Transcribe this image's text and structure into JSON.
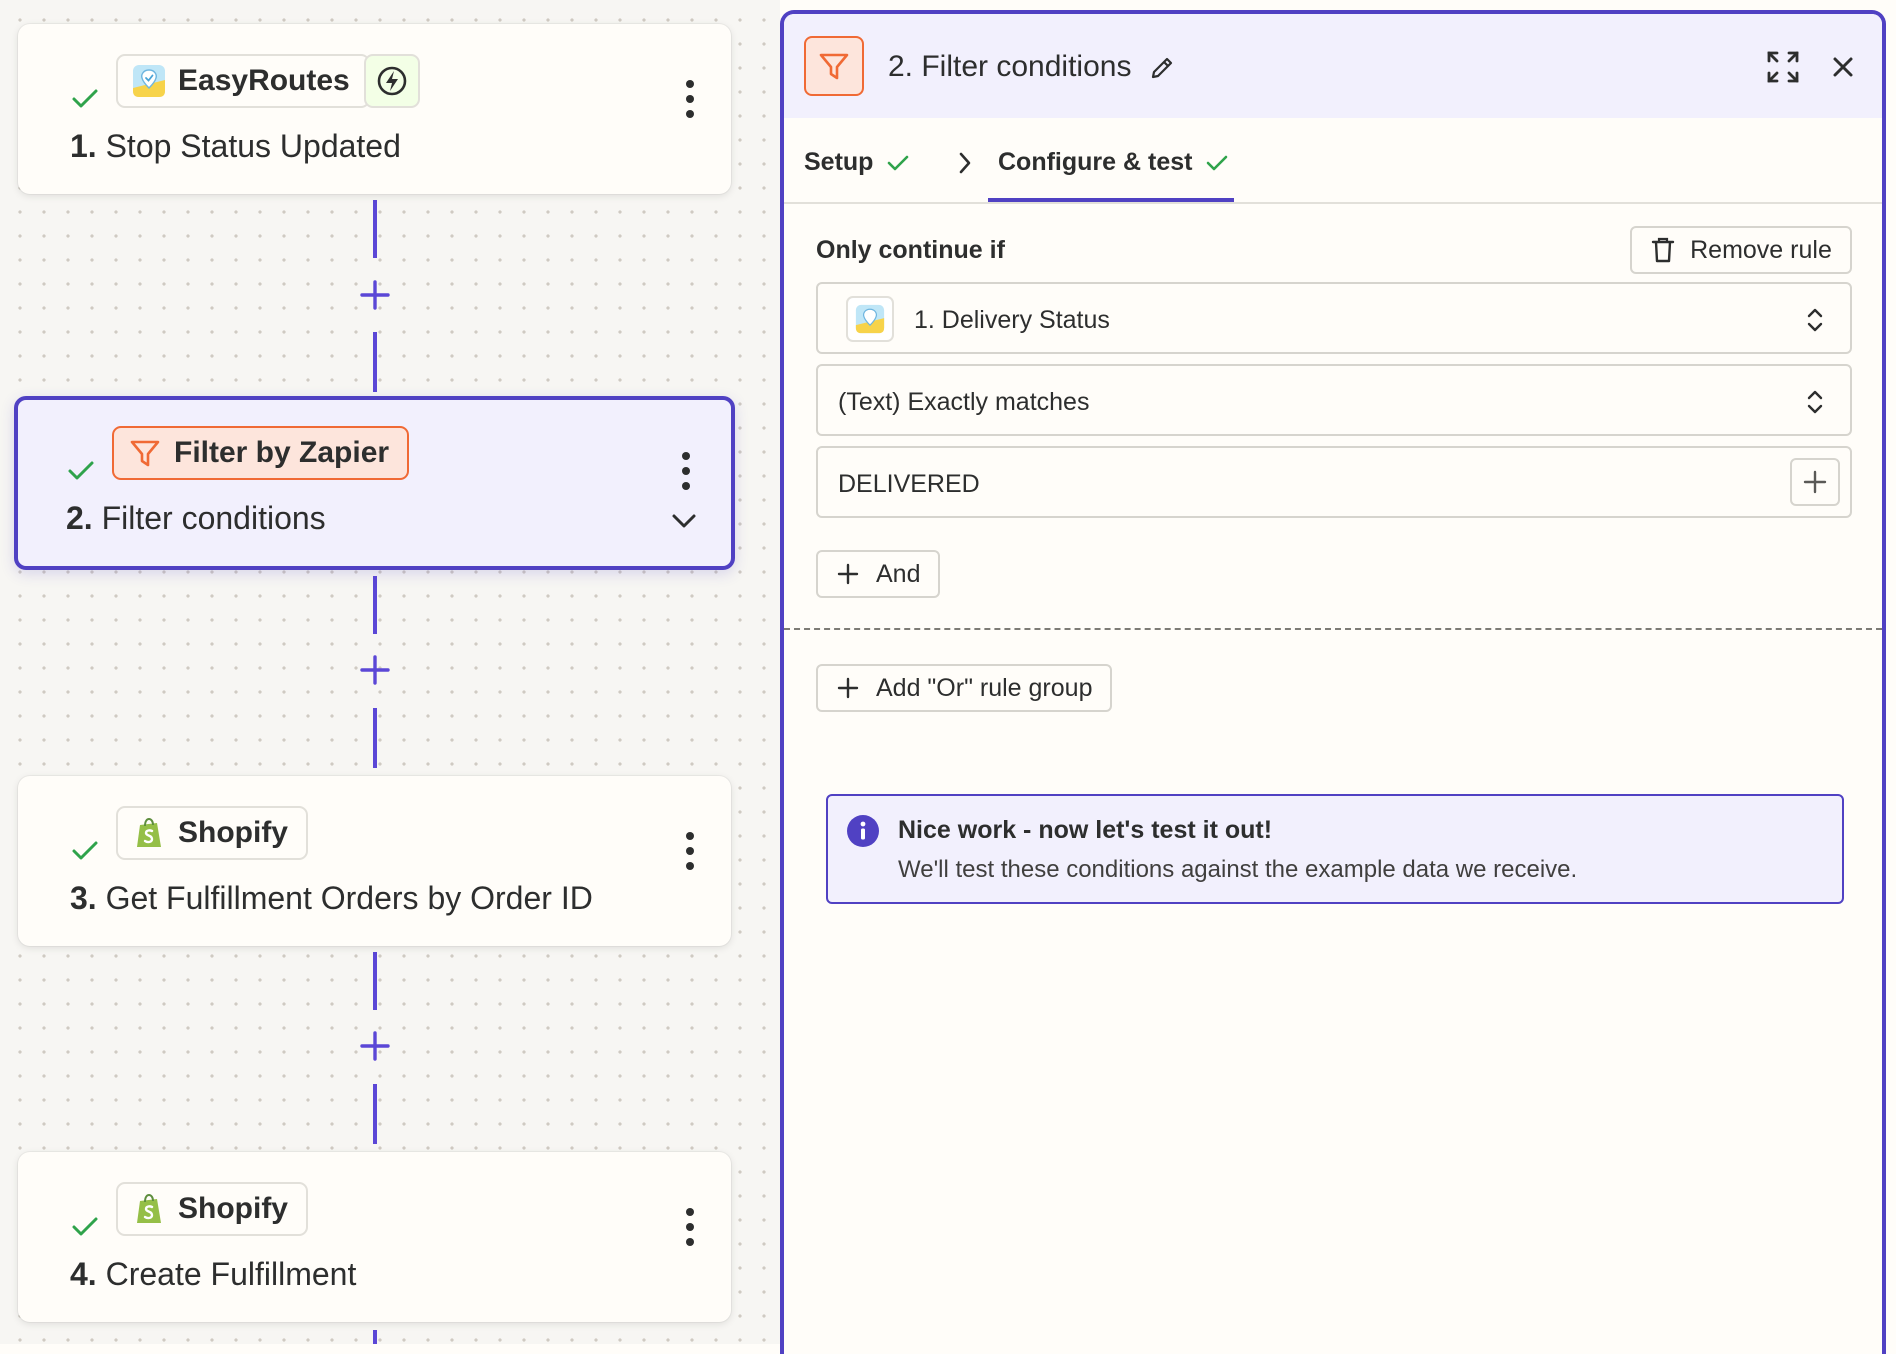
{
  "colors": {
    "accent": "#5041c3",
    "success": "#2fa34b",
    "filter_orange": "#f06a35",
    "canvas_bg": "#f7f6f3"
  },
  "steps": [
    {
      "app": "EasyRoutes",
      "app_icon": "easyroutes-icon",
      "number": "1.",
      "title": "Stop Status Updated",
      "status": "check-icon",
      "has_trigger_badge": true
    },
    {
      "app": "Filter by Zapier",
      "app_icon": "filter-icon",
      "number": "2.",
      "title": "Filter conditions",
      "status": "check-icon",
      "selected": true
    },
    {
      "app": "Shopify",
      "app_icon": "shopify-icon",
      "number": "3.",
      "title": "Get Fulfillment Orders by Order ID",
      "status": "check-icon"
    },
    {
      "app": "Shopify",
      "app_icon": "shopify-icon",
      "number": "4.",
      "title": "Create Fulfillment",
      "status": "check-icon"
    }
  ],
  "panel": {
    "title": "2. Filter conditions",
    "tabs": [
      {
        "label": "Setup",
        "complete": true
      },
      {
        "label": "Configure & test",
        "complete": true,
        "active": true
      }
    ],
    "rule_label": "Only continue if",
    "remove_rule_label": "Remove rule",
    "field_value": "1. Delivery Status",
    "condition": "(Text) Exactly matches",
    "match_value": "DELIVERED",
    "and_label": "And",
    "or_group_label": "Add \"Or\" rule group",
    "info": {
      "title": "Nice work - now let's test it out!",
      "body": "We'll test these conditions against the example data we receive."
    }
  }
}
